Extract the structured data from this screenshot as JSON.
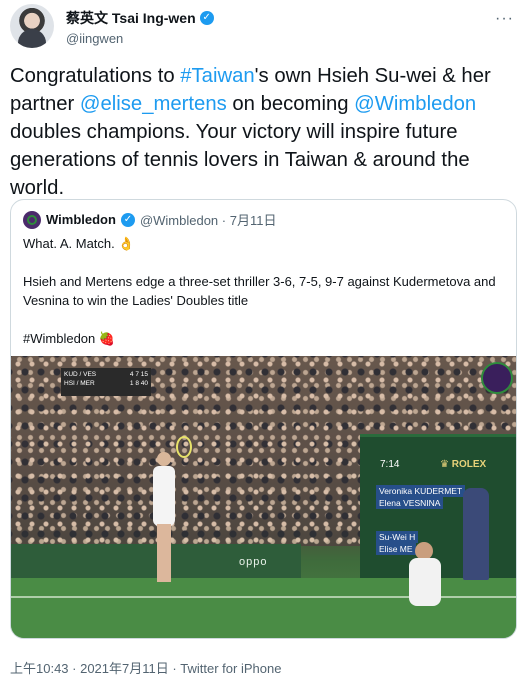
{
  "tweet": {
    "author": {
      "display_name": "蔡英文 Tsai Ing-wen",
      "handle": "@iingwen",
      "verified_icon": "check"
    },
    "more_icon": "···",
    "text": {
      "p1": "Congratulations to ",
      "link1": "#Taiwan",
      "p2": "'s own Hsieh Su-wei & her partner ",
      "link2": "@elise_mertens",
      "p3": " on becoming ",
      "link3": "@Wimbledon",
      "p4": " doubles champions. Your victory will inspire future generations of tennis lovers in Taiwan & around the world."
    },
    "footer": "上午10:43 · 2021年7月11日 · Twitter for iPhone"
  },
  "quote": {
    "name": "Wimbledon",
    "verified_icon": "check",
    "meta": "@Wimbledon · 7月11日",
    "line1": "What. A. Match. 👌",
    "line2": "Hsieh and Mertens edge a three-set thriller 3-6, 7-5, 9-7 against Kudermetova and Vesnina  to win the Ladies' Doubles title",
    "line3": "#Wimbledon 🍓"
  },
  "video": {
    "score_bug": {
      "team1": "KUD / VES",
      "team1_scores": [
        "4",
        "7",
        "15"
      ],
      "team2": "HSI / MER",
      "team2_scores": [
        "1",
        "8",
        "40"
      ]
    },
    "scoreboard": {
      "time": "7:14",
      "brand": "♛ ROLEX",
      "row1": "Veronika KUDERMET",
      "row2": "Elena VESNINA",
      "row3": "Su-Wei H",
      "row4": "Elise ME"
    },
    "sponsor": "oppo"
  },
  "colors": {
    "link": "#1d9bf0",
    "secondary": "#536471",
    "border": "#cfd9de"
  }
}
